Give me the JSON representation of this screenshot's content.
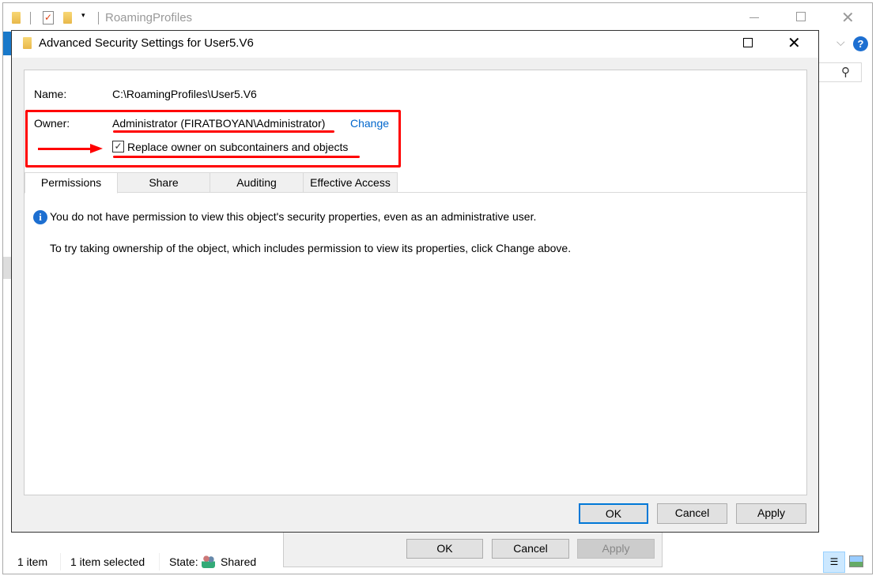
{
  "explorer": {
    "title": "RoamingProfiles",
    "status": {
      "items": "1 item",
      "selected": "1 item selected",
      "state_label": "State:",
      "state_value": "Shared"
    }
  },
  "back_dialog": {
    "ok": "OK",
    "cancel": "Cancel",
    "apply": "Apply"
  },
  "dialog": {
    "title": "Advanced Security Settings for User5.V6",
    "name_label": "Name:",
    "name_value": "C:\\RoamingProfiles\\User5.V6",
    "owner_label": "Owner:",
    "owner_value": "Administrator (FIRATBOYAN\\Administrator)",
    "change_link": "Change",
    "replace_owner": {
      "label": "Replace owner on subcontainers and objects",
      "checked": true
    },
    "tabs": [
      {
        "label": "Permissions",
        "selected": true
      },
      {
        "label": "Share"
      },
      {
        "label": "Auditing"
      },
      {
        "label": "Effective Access"
      }
    ],
    "message1": "You do not have permission to view this object's security properties, even as an administrative user.",
    "message2": "To try taking ownership of the object, which includes permission to view its properties, click Change above.",
    "ok": "OK",
    "cancel": "Cancel",
    "apply": "Apply"
  },
  "colors": {
    "annotation": "#ff0000",
    "link": "#0066cc",
    "accent": "#0078d7"
  }
}
